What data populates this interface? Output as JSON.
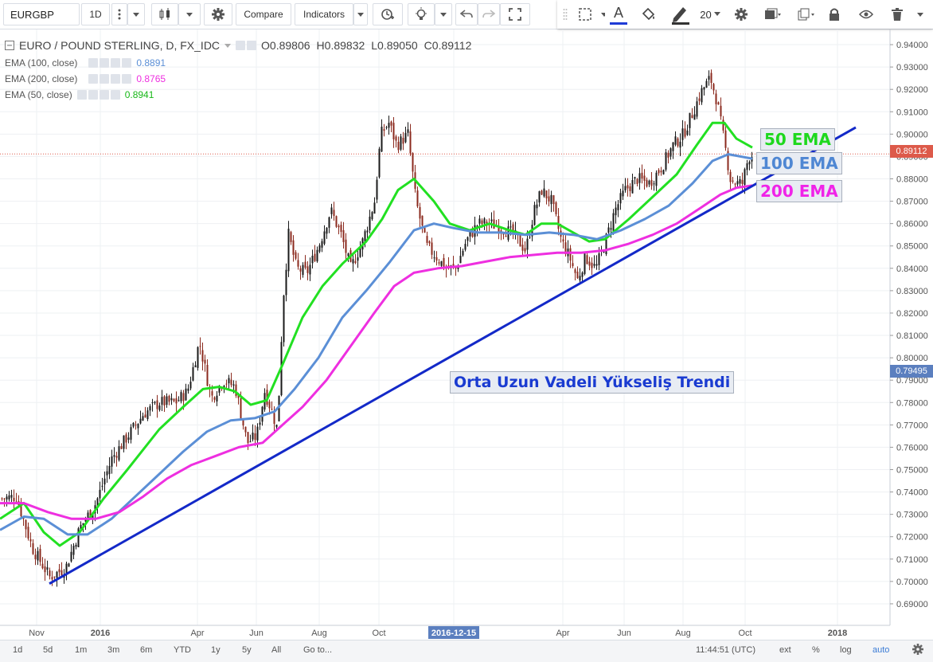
{
  "toolbar": {
    "symbol": "EURGBP",
    "interval": "1D",
    "compare_label": "Compare",
    "indicators_label": "Indicators",
    "font_size": "20"
  },
  "legend": {
    "title": "EURO / POUND STERLING, D, FX_IDC",
    "open": "O0.89806",
    "high": "H0.89832",
    "low": "L0.89050",
    "close": "C0.89112",
    "ema100_label": "EMA (100, close)",
    "ema100_value": "0.8891",
    "ema200_label": "EMA (200, close)",
    "ema200_value": "0.8765",
    "ema50_label": "EMA (50, close)",
    "ema50_value": "0.8941"
  },
  "annotations": {
    "ema50": "50 EMA",
    "ema100": "100 EMA",
    "ema200": "200 EMA",
    "trend": "Orta Uzun Vadeli Yükseliş Trendi"
  },
  "price_tags": {
    "current": "0.89112",
    "line": "0.79495"
  },
  "bottom": {
    "ranges": [
      "1d",
      "5d",
      "1m",
      "3m",
      "6m",
      "YTD",
      "1y",
      "5y",
      "All"
    ],
    "goto": "Go to...",
    "time": "11:44:51 (UTC)",
    "ext": "ext",
    "percent": "%",
    "log": "log",
    "auto": "auto"
  },
  "colors": {
    "up_candle": "#1a1a1a",
    "down_candle": "#8b2a1e",
    "ema50": "#22e022",
    "ema100": "#5b8fd6",
    "ema200": "#ee2fe0",
    "trendline": "#1329c8",
    "ann_ema50": "#1ed81e",
    "ann_ema100": "#4f87d3",
    "ann_ema200": "#f024e8",
    "ann_trend": "#1a3bd1",
    "price_tag": "#dd5a4a",
    "line_tag": "#5b7fbf"
  },
  "chart_data": {
    "type": "candlestick",
    "title": "EURO / POUND STERLING, D, FX_IDC",
    "x_labels": [
      "Nov",
      "2016",
      "Apr",
      "Jun",
      "Aug",
      "Oct",
      "2016-12-15",
      "Apr",
      "Jun",
      "Aug",
      "Oct",
      "2018"
    ],
    "y_ticks": [
      0.69,
      0.7,
      0.71,
      0.72,
      0.73,
      0.74,
      0.75,
      0.76,
      0.77,
      0.78,
      0.79,
      0.8,
      0.81,
      0.82,
      0.83,
      0.84,
      0.85,
      0.86,
      0.87,
      0.88,
      0.89,
      0.9,
      0.91,
      0.92,
      0.93,
      0.94
    ],
    "ylim": [
      0.685,
      0.945
    ],
    "current_close": 0.89112,
    "close_path": [
      [
        0,
        0.737
      ],
      [
        20,
        0.738
      ],
      [
        40,
        0.715
      ],
      [
        62,
        0.702
      ],
      [
        82,
        0.706
      ],
      [
        100,
        0.724
      ],
      [
        120,
        0.735
      ],
      [
        140,
        0.755
      ],
      [
        160,
        0.765
      ],
      [
        180,
        0.775
      ],
      [
        200,
        0.78
      ],
      [
        220,
        0.78
      ],
      [
        235,
        0.785
      ],
      [
        250,
        0.807
      ],
      [
        265,
        0.782
      ],
      [
        280,
        0.79
      ],
      [
        295,
        0.787
      ],
      [
        310,
        0.762
      ],
      [
        322,
        0.765
      ],
      [
        332,
        0.785
      ],
      [
        342,
        0.775
      ],
      [
        348,
        0.768
      ],
      [
        355,
        0.825
      ],
      [
        362,
        0.855
      ],
      [
        372,
        0.84
      ],
      [
        385,
        0.838
      ],
      [
        400,
        0.85
      ],
      [
        415,
        0.866
      ],
      [
        428,
        0.855
      ],
      [
        440,
        0.84
      ],
      [
        455,
        0.852
      ],
      [
        470,
        0.87
      ],
      [
        478,
        0.9
      ],
      [
        488,
        0.905
      ],
      [
        498,
        0.895
      ],
      [
        512,
        0.9
      ],
      [
        522,
        0.87
      ],
      [
        535,
        0.85
      ],
      [
        548,
        0.845
      ],
      [
        560,
        0.84
      ],
      [
        572,
        0.84
      ],
      [
        585,
        0.852
      ],
      [
        600,
        0.86
      ],
      [
        615,
        0.86
      ],
      [
        630,
        0.858
      ],
      [
        645,
        0.855
      ],
      [
        660,
        0.848
      ],
      [
        670,
        0.865
      ],
      [
        680,
        0.875
      ],
      [
        692,
        0.87
      ],
      [
        705,
        0.852
      ],
      [
        715,
        0.845
      ],
      [
        725,
        0.835
      ],
      [
        735,
        0.845
      ],
      [
        748,
        0.84
      ],
      [
        760,
        0.852
      ],
      [
        772,
        0.866
      ],
      [
        785,
        0.875
      ],
      [
        800,
        0.88
      ],
      [
        815,
        0.878
      ],
      [
        830,
        0.885
      ],
      [
        845,
        0.895
      ],
      [
        858,
        0.9
      ],
      [
        870,
        0.91
      ],
      [
        882,
        0.92
      ],
      [
        892,
        0.925
      ],
      [
        900,
        0.915
      ],
      [
        910,
        0.895
      ],
      [
        917,
        0.88
      ],
      [
        925,
        0.878
      ],
      [
        932,
        0.878
      ],
      [
        940,
        0.89
      ],
      [
        946,
        0.891
      ]
    ],
    "series": [
      {
        "name": "EMA (50, close)",
        "last": 0.8941,
        "points": [
          [
            0,
            0.728
          ],
          [
            30,
            0.735
          ],
          [
            55,
            0.722
          ],
          [
            75,
            0.716
          ],
          [
            100,
            0.722
          ],
          [
            130,
            0.737
          ],
          [
            160,
            0.75
          ],
          [
            200,
            0.768
          ],
          [
            230,
            0.778
          ],
          [
            255,
            0.786
          ],
          [
            275,
            0.787
          ],
          [
            295,
            0.785
          ],
          [
            315,
            0.779
          ],
          [
            335,
            0.781
          ],
          [
            355,
            0.797
          ],
          [
            380,
            0.818
          ],
          [
            405,
            0.832
          ],
          [
            430,
            0.842
          ],
          [
            460,
            0.852
          ],
          [
            480,
            0.862
          ],
          [
            500,
            0.875
          ],
          [
            520,
            0.88
          ],
          [
            545,
            0.87
          ],
          [
            565,
            0.86
          ],
          [
            590,
            0.857
          ],
          [
            615,
            0.86
          ],
          [
            640,
            0.857
          ],
          [
            660,
            0.855
          ],
          [
            680,
            0.86
          ],
          [
            700,
            0.86
          ],
          [
            720,
            0.856
          ],
          [
            740,
            0.852
          ],
          [
            760,
            0.853
          ],
          [
            790,
            0.862
          ],
          [
            820,
            0.872
          ],
          [
            850,
            0.882
          ],
          [
            875,
            0.895
          ],
          [
            895,
            0.905
          ],
          [
            910,
            0.905
          ],
          [
            925,
            0.898
          ],
          [
            945,
            0.894
          ]
        ]
      },
      {
        "name": "EMA (100, close)",
        "last": 0.8891,
        "points": [
          [
            0,
            0.723
          ],
          [
            30,
            0.729
          ],
          [
            55,
            0.728
          ],
          [
            85,
            0.721
          ],
          [
            110,
            0.721
          ],
          [
            140,
            0.728
          ],
          [
            170,
            0.738
          ],
          [
            200,
            0.748
          ],
          [
            230,
            0.758
          ],
          [
            260,
            0.767
          ],
          [
            290,
            0.772
          ],
          [
            320,
            0.773
          ],
          [
            345,
            0.776
          ],
          [
            370,
            0.786
          ],
          [
            400,
            0.8
          ],
          [
            430,
            0.818
          ],
          [
            460,
            0.83
          ],
          [
            490,
            0.843
          ],
          [
            520,
            0.857
          ],
          [
            545,
            0.86
          ],
          [
            570,
            0.858
          ],
          [
            600,
            0.856
          ],
          [
            630,
            0.856
          ],
          [
            660,
            0.855
          ],
          [
            690,
            0.856
          ],
          [
            720,
            0.855
          ],
          [
            750,
            0.853
          ],
          [
            780,
            0.857
          ],
          [
            810,
            0.862
          ],
          [
            840,
            0.868
          ],
          [
            870,
            0.878
          ],
          [
            895,
            0.888
          ],
          [
            915,
            0.891
          ],
          [
            945,
            0.889
          ]
        ]
      },
      {
        "name": "EMA (200, close)",
        "last": 0.8765,
        "points": [
          [
            0,
            0.735
          ],
          [
            30,
            0.735
          ],
          [
            60,
            0.731
          ],
          [
            90,
            0.728
          ],
          [
            120,
            0.728
          ],
          [
            150,
            0.731
          ],
          [
            180,
            0.738
          ],
          [
            210,
            0.746
          ],
          [
            240,
            0.752
          ],
          [
            270,
            0.756
          ],
          [
            300,
            0.76
          ],
          [
            330,
            0.762
          ],
          [
            355,
            0.77
          ],
          [
            380,
            0.778
          ],
          [
            410,
            0.79
          ],
          [
            440,
            0.805
          ],
          [
            470,
            0.82
          ],
          [
            495,
            0.832
          ],
          [
            520,
            0.838
          ],
          [
            550,
            0.84
          ],
          [
            580,
            0.841
          ],
          [
            610,
            0.843
          ],
          [
            640,
            0.845
          ],
          [
            670,
            0.846
          ],
          [
            700,
            0.847
          ],
          [
            730,
            0.847
          ],
          [
            760,
            0.848
          ],
          [
            790,
            0.851
          ],
          [
            820,
            0.855
          ],
          [
            850,
            0.86
          ],
          [
            880,
            0.867
          ],
          [
            905,
            0.873
          ],
          [
            925,
            0.876
          ],
          [
            945,
            0.877
          ]
        ]
      }
    ],
    "trendline": {
      "from": [
        62,
        0.699
      ],
      "to": [
        1075,
        0.903
      ]
    },
    "annotations": [
      "50 EMA",
      "100 EMA",
      "200 EMA",
      "Orta Uzun Vadeli Yükseliş Trendi"
    ]
  }
}
